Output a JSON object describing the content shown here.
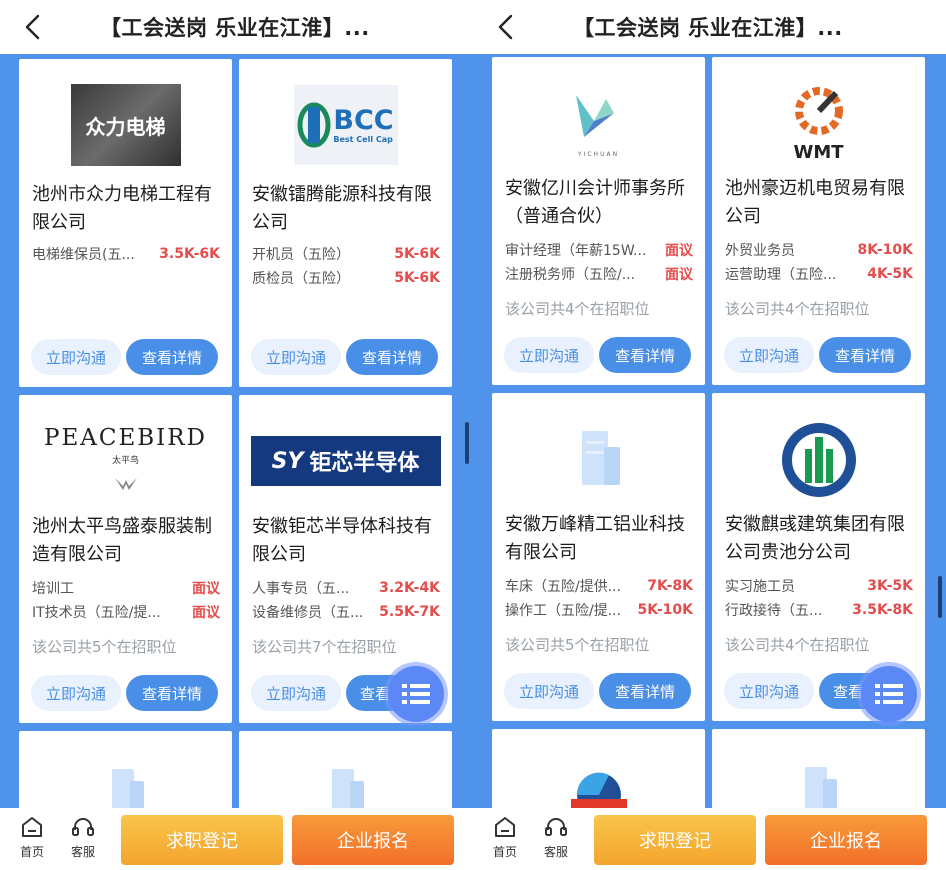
{
  "header": {
    "title": "【工会送岗 乐业在江淮】..."
  },
  "bottom": {
    "home": "首页",
    "service": "客服",
    "register": "求职登记",
    "enterprise": "企业报名"
  },
  "buttons": {
    "chat": "立即沟通",
    "detail": "查看详情",
    "detail_partial": "查看"
  },
  "left": {
    "cards": [
      {
        "logo_text": "众力电梯",
        "name": "池州市众力电梯工程有限公司",
        "jobs": [
          {
            "name": "电梯维保员(五...",
            "salary": "3.5K-6K"
          }
        ]
      },
      {
        "logo_text": "BCC",
        "logo_sub": "Best Cell Cap",
        "name": "安徽镭腾能源科技有限公司",
        "jobs": [
          {
            "name": "开机员（五险）",
            "salary": "5K-6K"
          },
          {
            "name": "质检员（五险）",
            "salary": "5K-6K"
          }
        ]
      },
      {
        "logo_text": "PEACEBIRD",
        "logo_sub": "太平鸟",
        "name": "池州太平鸟盛泰服装制造有限公司",
        "jobs": [
          {
            "name": "培训工",
            "salary": "面议"
          },
          {
            "name": "IT技术员（五险/提...",
            "salary": "面议"
          }
        ],
        "count": "该公司共5个在招职位"
      },
      {
        "logo_text": "钜芯半导体",
        "logo_sub": "SY",
        "name": "安徽钜芯半导体科技有限公司",
        "jobs": [
          {
            "name": "人事专员（五...",
            "salary": "3.2K-4K"
          },
          {
            "name": "设备维修员（五...",
            "salary": "5.5K-7K"
          }
        ],
        "count": "该公司共7个在招职位"
      }
    ]
  },
  "right": {
    "cards": [
      {
        "logo_text": "YICHUAN",
        "name": "安徽亿川会计师事务所（普通合伙）",
        "jobs": [
          {
            "name": "审计经理（年薪15W...",
            "salary": "面议"
          },
          {
            "name": "注册税务师（五险/...",
            "salary": "面议"
          }
        ],
        "count": "该公司共4个在招职位"
      },
      {
        "logo_text": "WMT",
        "name": "池州豪迈机电贸易有限公司",
        "jobs": [
          {
            "name": "外贸业务员",
            "salary": "8K-10K"
          },
          {
            "name": "运营助理（五险...",
            "salary": "4K-5K"
          }
        ],
        "count": "该公司共4个在招职位"
      },
      {
        "name": "安徽万峰精工铝业科技有限公司",
        "jobs": [
          {
            "name": "车床（五险/提供...",
            "salary": "7K-8K"
          },
          {
            "name": "操作工（五险/提...",
            "salary": "5K-10K"
          }
        ],
        "count": "该公司共5个在招职位"
      },
      {
        "name": "安徽麒彧建筑集团有限公司贵池分公司",
        "jobs": [
          {
            "name": "实习施工员",
            "salary": "3K-5K"
          },
          {
            "name": "行政接待（五...",
            "salary": "3.5K-8K"
          }
        ],
        "count": "该公司共4个在招职位"
      }
    ]
  },
  "colors": {
    "accent": "#4a8fe7",
    "salary": "#e54c4c",
    "background_blue": "#4f93ec"
  }
}
